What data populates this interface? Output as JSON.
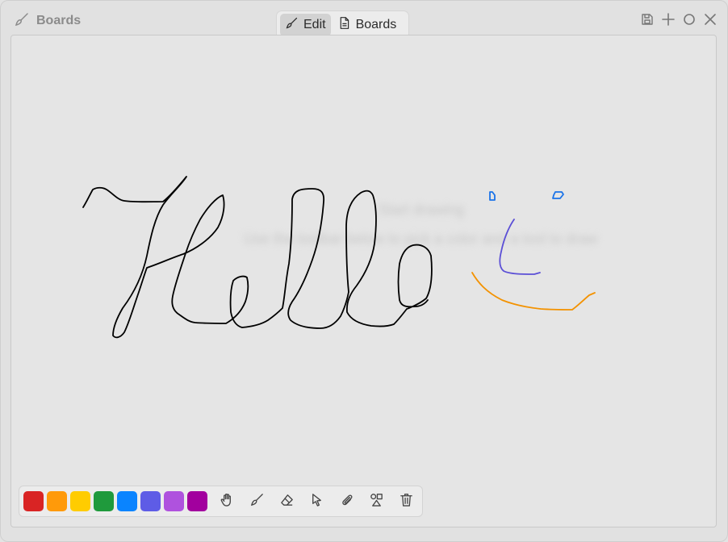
{
  "window": {
    "title": "Boards"
  },
  "mode_switcher": [
    {
      "label": "Edit",
      "icon": "brush-icon",
      "active": true
    },
    {
      "label": "Boards",
      "icon": "document-icon",
      "active": false
    }
  ],
  "window_controls": [
    "save-icon",
    "plus-icon",
    "circle-icon",
    "close-icon"
  ],
  "board": {
    "ghost_text_line1": "Start drawing",
    "ghost_text_line2": "Use the toolbar below to pick a color and a tool to draw",
    "strokes": [
      {
        "name": "hello-handwriting",
        "color": "#000000"
      },
      {
        "name": "left-eye",
        "color": "#1a73e8"
      },
      {
        "name": "right-eye",
        "color": "#1a73e8"
      },
      {
        "name": "nose",
        "color": "#5b4fd6"
      },
      {
        "name": "smile",
        "color": "#f39200"
      }
    ]
  },
  "palette": [
    "#d92424",
    "#ff9a0a",
    "#ffcc00",
    "#1f9a3c",
    "#0a84ff",
    "#5e5ce6",
    "#af52de",
    "#a2009e"
  ],
  "tools": [
    "hand-icon",
    "brush-icon",
    "eraser-icon",
    "pointer-icon",
    "paperclip-icon",
    "shapes-icon",
    "trash-icon"
  ]
}
